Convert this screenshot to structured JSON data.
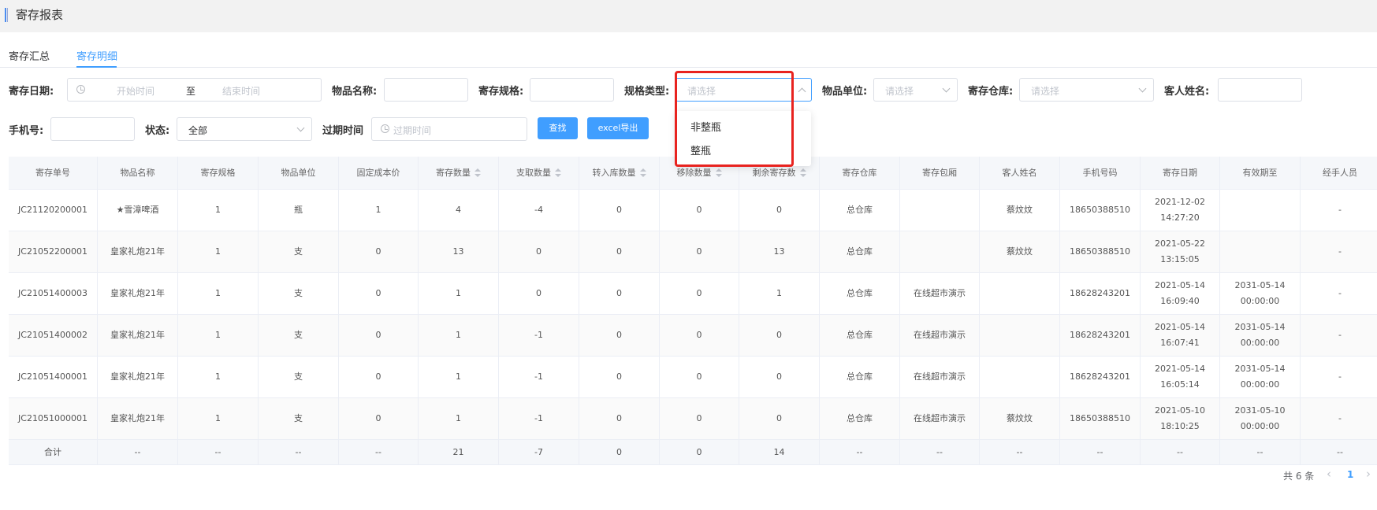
{
  "page": {
    "title": "寄存报表"
  },
  "tabs": [
    {
      "label": "寄存汇总"
    },
    {
      "label": "寄存明细"
    }
  ],
  "filters": {
    "deposit_date": {
      "label": "寄存日期:",
      "start_placeholder": "开始时间",
      "separator": "至",
      "end_placeholder": "结束时间"
    },
    "item_name": {
      "label": "物品名称:"
    },
    "spec": {
      "label": "寄存规格:"
    },
    "spec_type": {
      "label": "规格类型:",
      "placeholder": "请选择"
    },
    "item_unit": {
      "label": "物品单位:",
      "placeholder": "请选择"
    },
    "warehouse": {
      "label": "寄存仓库:",
      "placeholder": "请选择"
    },
    "guest_name": {
      "label": "客人姓名:"
    },
    "phone": {
      "label": "手机号:"
    },
    "status": {
      "label": "状态:",
      "value": "全部"
    },
    "expire": {
      "label": "过期时间",
      "placeholder": "过期时间"
    },
    "search_label": "查找",
    "export_label": "excel导出"
  },
  "dropdown": {
    "options": [
      "非整瓶",
      "整瓶"
    ]
  },
  "table": {
    "columns": [
      "寄存单号",
      "物品名称",
      "寄存规格",
      "物品单位",
      "固定成本价",
      "寄存数量",
      "支取数量",
      "转入库数量",
      "移除数量",
      "剩余寄存数",
      "寄存仓库",
      "寄存包厢",
      "客人姓名",
      "手机号码",
      "寄存日期",
      "有效期至",
      "经手人员"
    ],
    "rows": [
      [
        "JC21120200001",
        "★雪漳啤酒",
        "1",
        "瓶",
        "1",
        "4",
        "-4",
        "0",
        "0",
        "0",
        "总仓库",
        "",
        "蔡炆炆",
        "18650388510",
        "2021-12-02 14:27:20",
        "",
        "-"
      ],
      [
        "JC21052200001",
        "皇家礼炮21年",
        "1",
        "支",
        "0",
        "13",
        "0",
        "0",
        "0",
        "13",
        "总仓库",
        "",
        "蔡炆炆",
        "18650388510",
        "2021-05-22 13:15:05",
        "",
        "-"
      ],
      [
        "JC21051400003",
        "皇家礼炮21年",
        "1",
        "支",
        "0",
        "1",
        "0",
        "0",
        "0",
        "1",
        "总仓库",
        "在线超市演示",
        "",
        "18628243201",
        "2021-05-14 16:09:40",
        "2031-05-14 00:00:00",
        "-"
      ],
      [
        "JC21051400002",
        "皇家礼炮21年",
        "1",
        "支",
        "0",
        "1",
        "-1",
        "0",
        "0",
        "0",
        "总仓库",
        "在线超市演示",
        "",
        "18628243201",
        "2021-05-14 16:07:41",
        "2031-05-14 00:00:00",
        "-"
      ],
      [
        "JC21051400001",
        "皇家礼炮21年",
        "1",
        "支",
        "0",
        "1",
        "-1",
        "0",
        "0",
        "0",
        "总仓库",
        "在线超市演示",
        "",
        "18628243201",
        "2021-05-14 16:05:14",
        "2031-05-14 00:00:00",
        "-"
      ],
      [
        "JC21051000001",
        "皇家礼炮21年",
        "1",
        "支",
        "0",
        "1",
        "-1",
        "0",
        "0",
        "0",
        "总仓库",
        "在线超市演示",
        "蔡炆炆",
        "18650388510",
        "2021-05-10 18:10:25",
        "2031-05-10 00:00:00",
        "-"
      ]
    ],
    "summary": [
      "合计",
      "--",
      "--",
      "--",
      "--",
      "21",
      "-7",
      "0",
      "0",
      "14",
      "--",
      "--",
      "--",
      "--",
      "--",
      "--",
      "--"
    ]
  },
  "pagination": {
    "total": "共 6 条",
    "prev_icon": "‹",
    "current": "1",
    "next_icon": "›"
  }
}
